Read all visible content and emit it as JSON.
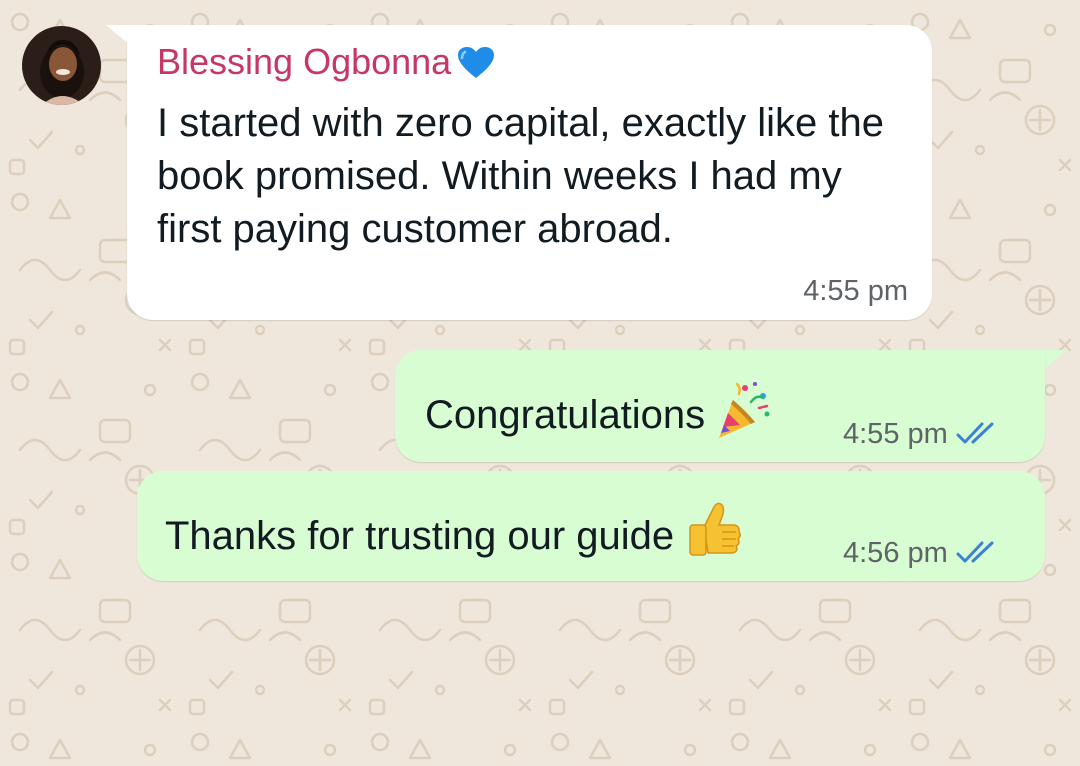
{
  "chat": {
    "incoming": {
      "sender": "Blessing Ogbonna",
      "sender_emoji": "blue-heart-icon",
      "text": "I started with zero capital, exactly like the book promised. Within weeks I had my first paying customer abroad.",
      "time": "4:55 pm"
    },
    "outgoing": [
      {
        "text": "Congratulations",
        "emoji": "party-popper-icon",
        "time": "4:55 pm",
        "status": "read"
      },
      {
        "text": "Thanks for trusting our guide",
        "emoji": "thumbs-up-icon",
        "time": "4:56 pm",
        "status": "read"
      }
    ]
  },
  "colors": {
    "wallpaper": "#efe7dc",
    "incoming_bubble": "#ffffff",
    "outgoing_bubble": "#d9fdd3",
    "sender_name": "#c73766",
    "read_ticks": "#3b82d6",
    "timestamp": "#5e6368"
  }
}
